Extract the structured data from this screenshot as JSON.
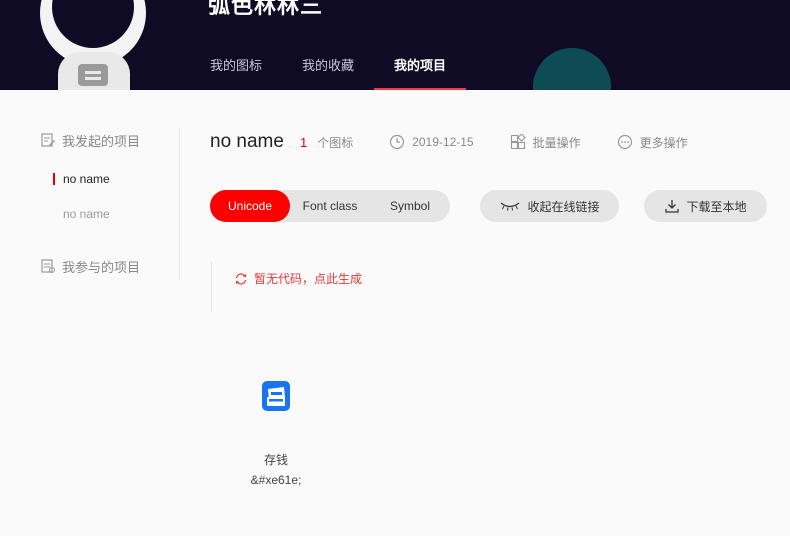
{
  "header": {
    "username": "弧色林林三",
    "tabs": [
      {
        "label": "我的图标",
        "active": false
      },
      {
        "label": "我的收藏",
        "active": false
      },
      {
        "label": "我的项目",
        "active": true
      }
    ],
    "accent_color": "#f6373e",
    "background_color": "#0f0b24"
  },
  "sidebar": {
    "started_label": "我发起的项目",
    "started_items": [
      {
        "label": "no name",
        "active": true
      },
      {
        "label": "no name",
        "active": false
      }
    ],
    "joined_label": "我参与的项目"
  },
  "project": {
    "name": "no name",
    "icon_count": "1",
    "icon_count_unit": "个图标",
    "date": "2019-12-15",
    "batch_label": "批量操作",
    "more_label": "更多操作"
  },
  "toolbar": {
    "modes": [
      {
        "label": "Unicode",
        "active": true
      },
      {
        "label": "Font class",
        "active": false
      },
      {
        "label": "Symbol",
        "active": false
      }
    ],
    "collapse_link_label": "收起在线链接",
    "download_label": "下载至本地",
    "active_color": "#ff0000"
  },
  "code": {
    "empty_message": "暂无代码，点此生成",
    "message_color": "#e53935"
  },
  "icons": [
    {
      "name": "存钱",
      "code": "&#xe61e;",
      "icon": "wallet-card-icon",
      "color": "#1a73f0"
    }
  ]
}
